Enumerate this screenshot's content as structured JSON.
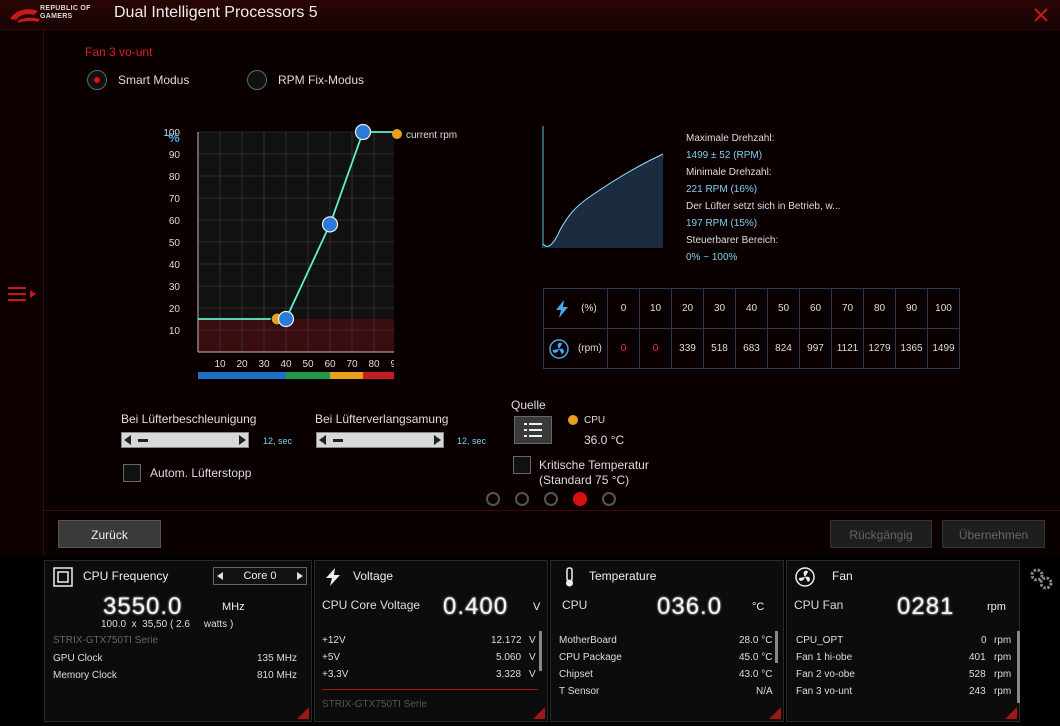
{
  "window": {
    "title": "Dual Intelligent Processors 5",
    "logo_line1": "REPUBLIC OF",
    "logo_line2": "GAMERS"
  },
  "fan": {
    "name": "Fan 3 vo-unt",
    "modes": [
      {
        "label": "Smart Modus",
        "selected": true
      },
      {
        "label": "RPM Fix-Modus",
        "selected": false
      }
    ],
    "chart": {
      "y_label": "%",
      "x_unit": "°C",
      "y_ticks": [
        "100",
        "90",
        "80",
        "70",
        "60",
        "50",
        "40",
        "30",
        "20",
        "10"
      ],
      "x_ticks": [
        "10",
        "20",
        "30",
        "40",
        "50",
        "60",
        "70",
        "80",
        "90",
        "100"
      ],
      "curve_points": [
        [
          0,
          15
        ],
        [
          40,
          15
        ],
        [
          60,
          58
        ],
        [
          75,
          100
        ],
        [
          100,
          100
        ]
      ],
      "current_point": [
        36,
        15
      ],
      "legend": "current rpm",
      "bands": [
        "#1e6fc8",
        "#1f9a4a",
        "#e8a01c",
        "#c02020"
      ]
    },
    "info": {
      "max_label": "Maximale Drehzahl:",
      "max_value": "1499 ± 52 (RPM)",
      "min_label": "Minimale Drehzahl:",
      "min_value": "221 RPM (16%)",
      "start_label": "Der Lüfter setzt sich in Betrieb, w...",
      "start_value": "197 RPM (15%)",
      "range_label": "Steuerbarer Bereich:",
      "range_value": "0% ~ 100%"
    },
    "table": {
      "percent_label": "(%)",
      "rpm_label": "(rpm)",
      "percent": [
        "0",
        "10",
        "20",
        "30",
        "40",
        "50",
        "60",
        "70",
        "80",
        "90",
        "100"
      ],
      "rpm": [
        "0",
        "0",
        "339",
        "518",
        "683",
        "824",
        "997",
        "1121",
        "1279",
        "1365",
        "1499"
      ]
    },
    "accel_label": "Bei Lüfterbeschleunigung",
    "accel_value": "12, sec",
    "decel_label": "Bei Lüfterverlangsamung",
    "decel_value": "12, sec",
    "auto_stop_label": "Autom. Lüfterstopp",
    "source_label": "Quelle",
    "source_name": "CPU",
    "source_temp": "36.0 °C",
    "critical_line1": "Kritische Temperatur",
    "critical_line2": "(Standard 75 °C)",
    "active_page": 3
  },
  "buttons": {
    "back": "Zurück",
    "undo": "Rückgängig",
    "apply": "Übernehmen"
  },
  "cpu_panel": {
    "title": "CPU Frequency",
    "core": "Core 0",
    "freq": "3550.0",
    "freq_unit": "MHz",
    "ratio_line": "100.0  x  35,50 ( 2.6     watts )",
    "gpu_name": "STRIX-GTX750TI Serie",
    "rows": [
      {
        "label": "GPU Clock",
        "value": "135 MHz"
      },
      {
        "label": "Memory Clock",
        "value": "810 MHz"
      }
    ]
  },
  "voltage_panel": {
    "title": "Voltage",
    "main_label": "CPU Core Voltage",
    "main_value": "0.400",
    "unit": "V",
    "rows": [
      {
        "label": "+12V",
        "value": "12.172",
        "unit": "V"
      },
      {
        "label": "+5V",
        "value": "5.060",
        "unit": "V"
      },
      {
        "label": "+3.3V",
        "value": "3.328",
        "unit": "V"
      }
    ],
    "footer": "STRIX-GTX750TI Serie"
  },
  "temp_panel": {
    "title": "Temperature",
    "main_label": "CPU",
    "main_value": "036.0",
    "unit": "°C",
    "rows": [
      {
        "label": "MotherBoard",
        "value": "28.0 °C"
      },
      {
        "label": "CPU Package",
        "value": "45.0 °C"
      },
      {
        "label": "Chipset",
        "value": "43.0 °C"
      },
      {
        "label": "T Sensor",
        "value": "N/A"
      }
    ]
  },
  "fan_panel": {
    "title": "Fan",
    "main_label": "CPU Fan",
    "main_value": "0281",
    "unit": "rpm",
    "rows": [
      {
        "label": "CPU_OPT",
        "value": "0",
        "unit": "rpm"
      },
      {
        "label": "Fan 1 hi-obe",
        "value": "401",
        "unit": "rpm"
      },
      {
        "label": "Fan 2 vo-obe",
        "value": "528",
        "unit": "rpm"
      },
      {
        "label": "Fan 3 vo-unt",
        "value": "243",
        "unit": "rpm"
      }
    ]
  }
}
